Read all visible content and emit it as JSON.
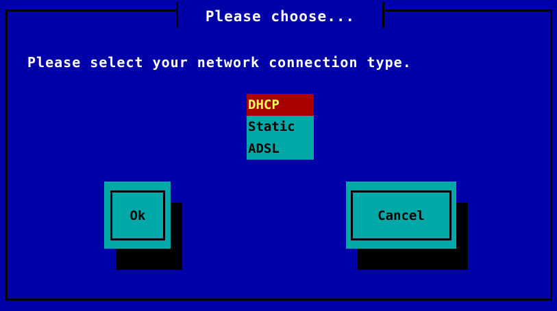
{
  "dialog": {
    "title": "Please choose...",
    "prompt": "Please select your network connection type."
  },
  "connection_types": {
    "selected": "DHCP",
    "options": [
      "DHCP",
      "Static",
      "ADSL"
    ]
  },
  "buttons": {
    "ok_label": "Ok",
    "cancel_label": "Cancel"
  },
  "colors": {
    "background": "#0000A8",
    "frame": "#000000",
    "list_background": "#00A8A8",
    "selected_background": "#A80000",
    "selected_text": "#FFFF54",
    "text": "#FFFFFF"
  }
}
